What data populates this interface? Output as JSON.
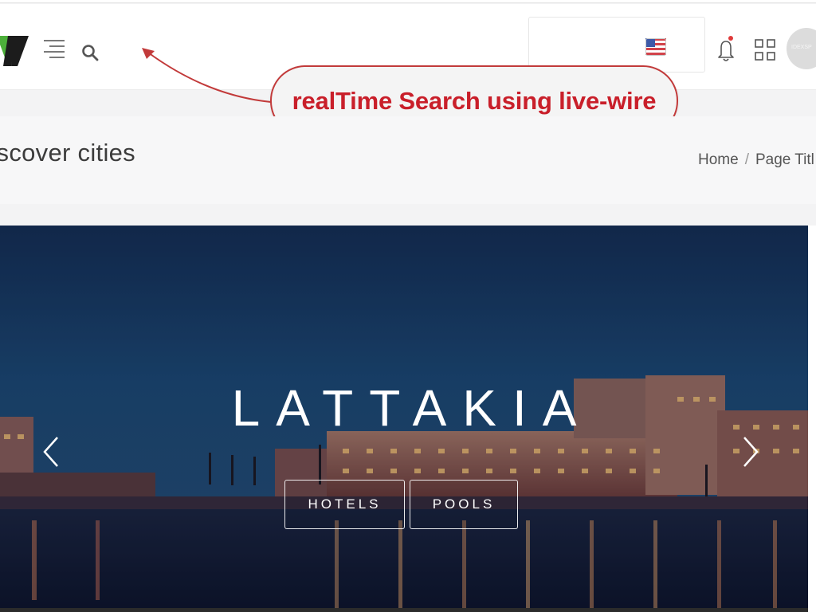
{
  "header": {
    "avatar_label": "IDEXSP"
  },
  "annotation": {
    "text": "realTime Search using live-wire"
  },
  "page_header": {
    "title": "escover cities",
    "breadcrumb": [
      "Home",
      "Page Titl"
    ]
  },
  "hero": {
    "title": "LATTAKIA",
    "buttons": [
      "HOTELS",
      "POOLS"
    ]
  },
  "colors": {
    "annotation_red": "#c91f2a",
    "annotation_border": "#c23a3a",
    "notification_dot": "#e03a3a"
  }
}
